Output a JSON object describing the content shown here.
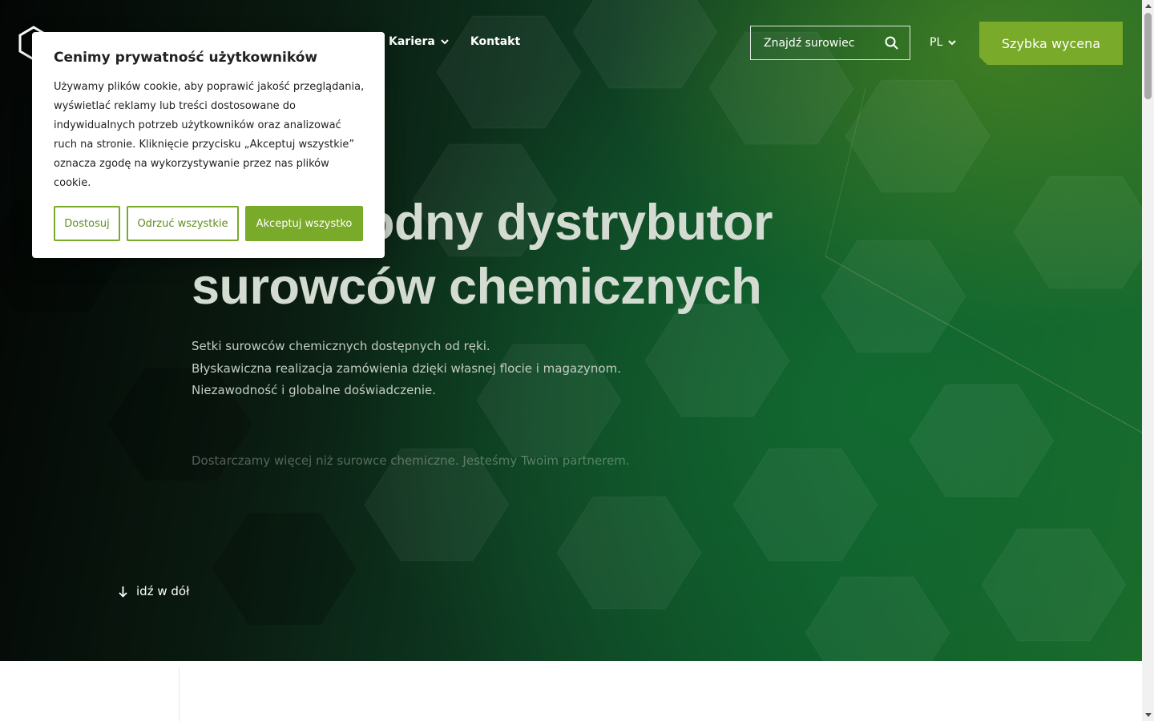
{
  "header": {
    "nav": [
      {
        "label": "Kariera",
        "has_dropdown": true,
        "icon": "chevron-down-icon"
      },
      {
        "label": "Kontakt",
        "has_dropdown": false
      }
    ],
    "search": {
      "placeholder": "Znajdź surowiec",
      "icon": "search-icon"
    },
    "language": {
      "label": "PL",
      "icon": "chevron-down-icon"
    },
    "cta_label": "Szybka wycena",
    "logo_icon": "hexagon-logo-icon"
  },
  "hero": {
    "title_line1": "odny dystrybutor",
    "title_line2": "surowców chemicznych",
    "lines": [
      "Setki surowców chemicznych dostępnych od ręki.",
      "Błyskawiczna realizacja zamówienia dzięki własnej flocie i magazynom.",
      "Niezawodność i globalne doświadczenie."
    ],
    "subtitle": "Dostarczamy więcej niż surowce chemiczne. Jesteśmy Twoim partnerem.",
    "scroll_label": "idź w dół",
    "scroll_icon": "arrow-down-icon"
  },
  "cookie_banner": {
    "title": "Cenimy prywatność użytkowników",
    "text": "Używamy plików cookie, aby poprawić jakość przeglądania, wyświetlać reklamy lub treści dostosowane do indywidualnych potrzeb użytkowników oraz analizować ruch na stronie. Kliknięcie przycisku „Akceptuj wszystkie” oznacza zgodę na wykorzystywanie przez nas plików cookie.",
    "buttons": {
      "customize": "Dostosuj",
      "reject": "Odrzuć wszystkie",
      "accept": "Akceptuj wszystko"
    }
  },
  "colors": {
    "accent": "#7aaa2a",
    "hero_dark": "#030504",
    "hero_green": "#0d5a2b"
  }
}
